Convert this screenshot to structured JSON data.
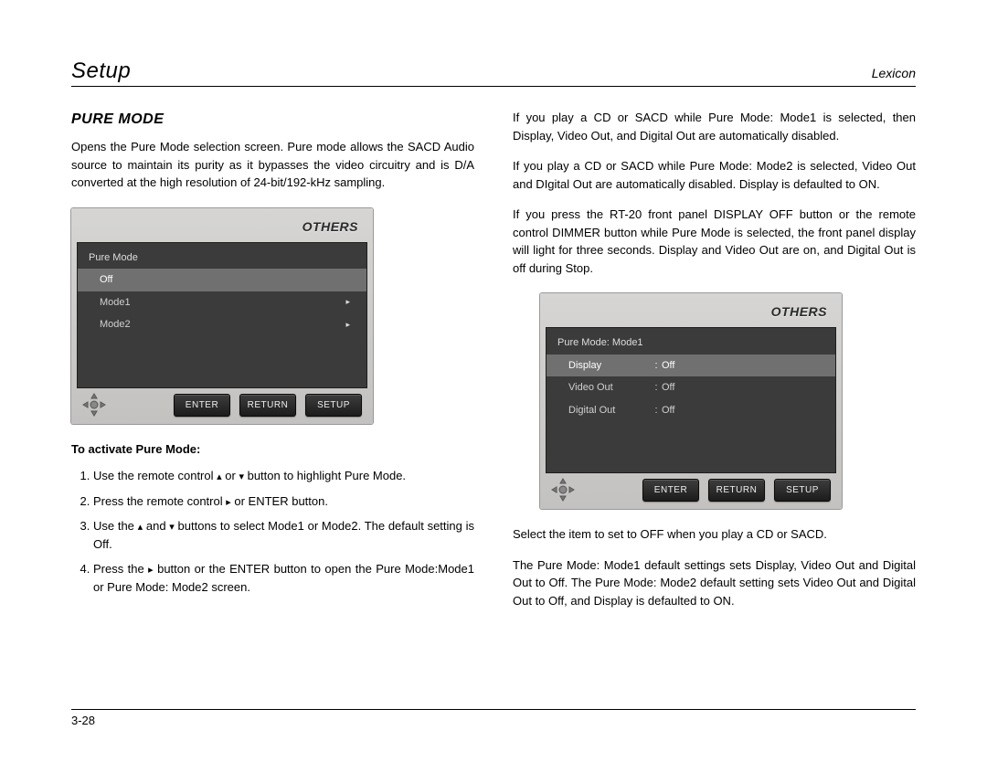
{
  "header": {
    "left": "Setup",
    "right": "Lexicon"
  },
  "footer": {
    "page": "3-28"
  },
  "glyphs": {
    "up": "▴",
    "down": "▾",
    "right": "▸"
  },
  "left_col": {
    "heading": "PURE MODE",
    "intro": "Opens the Pure Mode selection screen. Pure mode allows the SACD Audio source to maintain its purity as it bypasses the video circuitry and is D/A converted at the high resolution of 24-bit/192-kHz sampling.",
    "activate_label": "To activate Pure Mode:",
    "steps": {
      "s1a": "Use the remote control ",
      "s1b": " or ",
      "s1c": " button to highlight Pure Mode.",
      "s2a": "Press the remote control ",
      "s2b": "  or  ENTER button.",
      "s3a": "Use the ",
      "s3b": " and ",
      "s3c": "  buttons to select Mode1 or Mode2. The default setting is Off.",
      "s4a": "Press the  ",
      "s4b": "  button or the ENTER button to open the Pure Mode:Mode1 or Pure Mode: Mode2 screen."
    }
  },
  "right_col": {
    "p1": "If you play a CD or SACD while Pure Mode: Mode1 is selected, then Display, Video Out, and Digital Out are automatically disabled.",
    "p2": "If you play a CD or SACD while Pure Mode: Mode2 is selected, Video Out and DIgital Out are automatically disabled. Display is defaulted to ON.",
    "p3": "If you press the RT-20 front panel DISPLAY OFF button or the remote control DIMMER button while Pure Mode is selected, the front panel display will light for three seconds. Display and Video Out are on, and Digital Out is off during Stop.",
    "p4": "Select the item to set to OFF when you play a CD or SACD.",
    "p5": "The Pure Mode: Mode1 default settings sets Display, Video Out and Digital Out to Off. The Pure Mode: Mode2 default setting sets Video Out and Digital Out to Off, and Display is defaulted to ON."
  },
  "osd_a": {
    "title": "OTHERS",
    "header": "Pure Mode",
    "rows": [
      {
        "label": "Off",
        "arrow": false,
        "selected": true
      },
      {
        "label": "Mode1",
        "arrow": true,
        "selected": false
      },
      {
        "label": "Mode2",
        "arrow": true,
        "selected": false
      }
    ],
    "buttons": [
      "ENTER",
      "RETURN",
      "SETUP"
    ]
  },
  "osd_b": {
    "title": "OTHERS",
    "header": "Pure Mode: Mode1",
    "rows": [
      {
        "label": "Display",
        "value": "Off",
        "selected": true
      },
      {
        "label": "Video Out",
        "value": "Off",
        "selected": false
      },
      {
        "label": "Digital Out",
        "value": "Off",
        "selected": false
      }
    ],
    "buttons": [
      "ENTER",
      "RETURN",
      "SETUP"
    ]
  }
}
